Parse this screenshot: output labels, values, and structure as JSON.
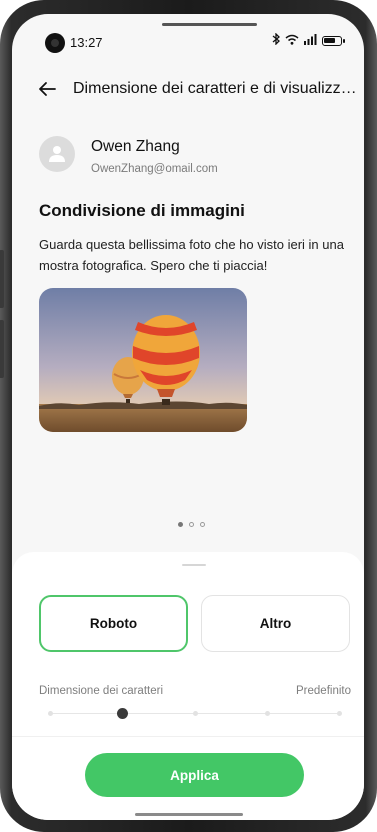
{
  "status_bar": {
    "time": "13:27",
    "icons": [
      "bluetooth-icon",
      "wifi-icon",
      "signal-icon",
      "battery-icon"
    ]
  },
  "header": {
    "back_icon": "arrow-left-icon",
    "title": "Dimensione dei caratteri e di visualizza..."
  },
  "preview": {
    "sender_name": "Owen Zhang",
    "sender_email": "OwenZhang@omail.com",
    "post_title": "Condivisione di immagini",
    "post_body": "Guarda questa bellissima foto che ho visto ieri in una mostra fotografica. Spero che ti piaccia!",
    "image": "hot-air-balloons-photo",
    "page_indicator": {
      "count": 3,
      "active": 0
    }
  },
  "sheet": {
    "font_options": [
      "Roboto",
      "Altro"
    ],
    "selected_font": "Roboto",
    "font_size_label": "Dimensione dei caratteri",
    "font_size_value": "Predefinito",
    "font_size_steps": 5,
    "font_size_selected_step": 1,
    "apply_label": "Applica"
  },
  "colors": {
    "accent": "#43c766",
    "selected_border": "#4fc66a",
    "background": "#f7f7f7",
    "sheet_background": "#ffffff"
  }
}
